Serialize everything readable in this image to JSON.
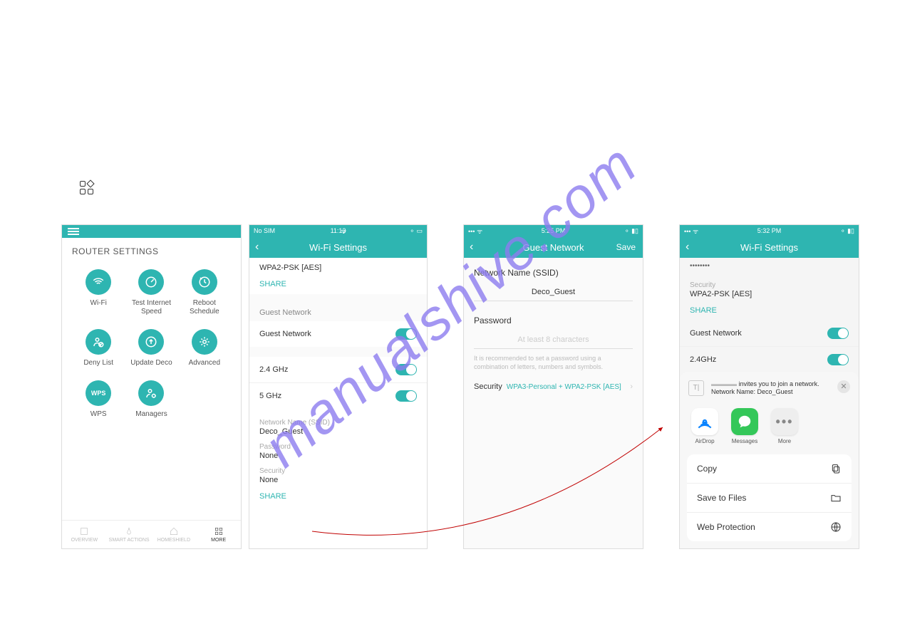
{
  "watermark": "manualshive.com",
  "screen1": {
    "title": "ROUTER SETTINGS",
    "icons": [
      "Wi-Fi",
      "Test Internet Speed",
      "Reboot Schedule",
      "Deny List",
      "Update Deco",
      "Advanced",
      "WPS",
      "Managers"
    ],
    "tabs": [
      "OVERVIEW",
      "SMART ACTIONS",
      "HOMESHIELD",
      "MORE"
    ]
  },
  "screen2": {
    "status_left": "No SIM",
    "status_time": "11:13",
    "title": "Wi-Fi Settings",
    "security_value": "WPA2-PSK [AES]",
    "share": "SHARE",
    "guest_section": "Guest Network",
    "guest_row": "Guest Network",
    "band24": "2.4 GHz",
    "band5": "5 GHz",
    "ssid_label": "Network Name (SSID)",
    "ssid_value": "Deco_Guest",
    "pw_label": "Password",
    "pw_value": "None",
    "sec_label": "Security",
    "sec_value": "None",
    "share2": "SHARE"
  },
  "screen3": {
    "status_time": "5:25 PM",
    "title": "Guest Network",
    "save": "Save",
    "ssid_label": "Network Name (SSID)",
    "ssid_value": "Deco_Guest",
    "pw_label": "Password",
    "pw_placeholder": "At least 8 characters",
    "help": "It is recommended to set a password using a combination of letters, numbers and symbols.",
    "sec_label": "Security",
    "sec_value": "WPA3-Personal + WPA2-PSK [AES]"
  },
  "screen4": {
    "status_time": "5:32 PM",
    "title": "Wi-Fi Settings",
    "dots": "••••••••",
    "sec_label": "Security",
    "sec_value": "WPA2-PSK [AES]",
    "share": "SHARE",
    "guest_row": "Guest Network",
    "band24": "2.4GHz",
    "invite_line1": "invites you to join a network.",
    "invite_line2": "Network Name: Deco_Guest",
    "apps": [
      "AirDrop",
      "Messages",
      "More"
    ],
    "actions": [
      "Copy",
      "Save to Files",
      "Web Protection"
    ]
  }
}
